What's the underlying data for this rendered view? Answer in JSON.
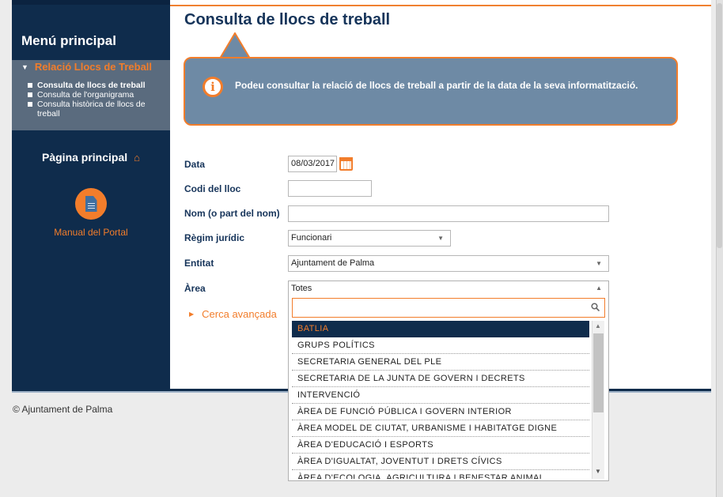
{
  "sidebar": {
    "title": "Menú principal",
    "section": "Relació Llocs de Treball",
    "items": [
      {
        "label": "Consulta de llocs de treball"
      },
      {
        "label": "Consulta de l'organigrama"
      },
      {
        "label": "Consulta històrica de llocs de treball"
      }
    ],
    "home_label": "Pàgina principal",
    "manual_label": "Manual del Portal"
  },
  "main": {
    "title": "Consulta de llocs de treball",
    "info_text": "Podeu consultar la relació de llocs de treball a partir de la data de la seva informatització."
  },
  "form": {
    "data_label": "Data",
    "data_value": "08/03/2017",
    "codi_label": "Codi del lloc",
    "codi_value": "",
    "nom_label": "Nom (o part del nom)",
    "nom_value": "",
    "regim_label": "Règim jurídic",
    "regim_value": "Funcionari",
    "entitat_label": "Entitat",
    "entitat_value": "Ajuntament de Palma",
    "area_label": "Àrea",
    "area_value": "Totes",
    "advanced_label": "Cerca avançada"
  },
  "dropdown": {
    "search_value": "",
    "options": [
      "BATLIA",
      "GRUPS POLÍTICS",
      "SECRETARIA GENERAL DEL PLE",
      "SECRETARIA DE LA JUNTA DE GOVERN I DECRETS",
      "INTERVENCIÓ",
      "ÀREA DE FUNCIÓ PÚBLICA I GOVERN INTERIOR",
      "ÀREA MODEL DE CIUTAT, URBANISME I HABITATGE DIGNE",
      "ÀREA D'EDUCACIÓ I ESPORTS",
      "ÀREA D'IGUALTAT, JOVENTUT I DRETS CÍVICS",
      "ÀREA D'ECOLOGIA, AGRICULTURA I BENESTAR ANIMAL"
    ],
    "selected": "BATLIA"
  },
  "footer": {
    "text": "© Ajuntament de Palma"
  },
  "colors": {
    "navy": "#0f2c4c",
    "accent": "#f27d2b",
    "info_bg": "#6e8aa5",
    "submenu_bg": "#5a6b7e"
  }
}
